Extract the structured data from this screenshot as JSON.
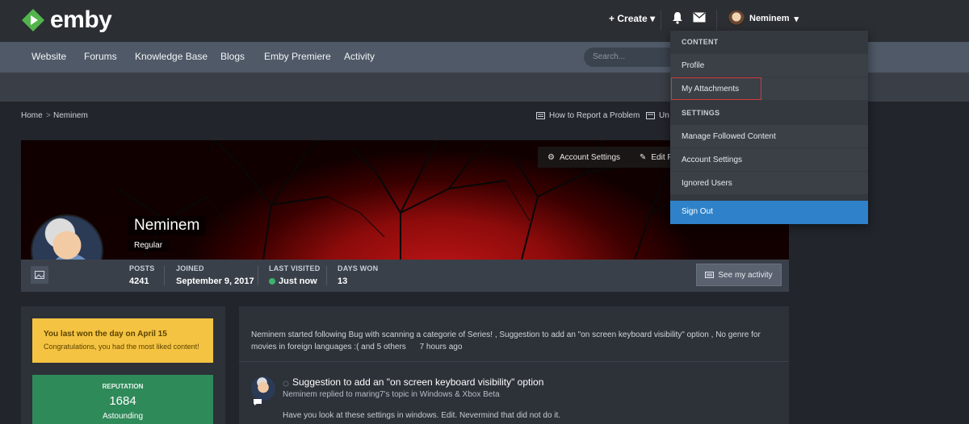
{
  "brand": {
    "name": "emby",
    "logo_color": "#52b54b"
  },
  "topbar": {
    "create_label": "Create",
    "notifications_icon": "bell-icon",
    "messages_icon": "envelope-icon",
    "username": "Neminem"
  },
  "nav": {
    "items": [
      "Website",
      "Forums",
      "Knowledge Base",
      "Blogs",
      "Emby Premiere",
      "Activity"
    ],
    "search_placeholder": "Search..."
  },
  "breadcrumb": {
    "home": "Home",
    "separator": ">",
    "current": "Neminem"
  },
  "breadcrumb_links": {
    "report": "How to Report a Problem",
    "second_truncated": "Un"
  },
  "cover": {
    "account_settings_label": "Account Settings",
    "edit_profile_label_truncated": "Edit P"
  },
  "profile": {
    "name": "Neminem",
    "title": "Regular",
    "stats": [
      {
        "label": "POSTS",
        "value": "4241"
      },
      {
        "label": "JOINED",
        "value": "September 9, 2017"
      },
      {
        "label": "LAST VISITED",
        "value": "Just now",
        "online": true
      },
      {
        "label": "DAYS WON",
        "value": "13"
      }
    ],
    "activity_button": "See my activity"
  },
  "sidebar": {
    "won": {
      "title": "You last won the day on April 15",
      "subtitle": "Congratulations, you had the most liked content!"
    },
    "reputation": {
      "label": "REPUTATION",
      "value": "1684",
      "rank": "Astounding"
    }
  },
  "feed": {
    "summary": "Neminem started following Bug with scanning a categorie of Series! , Suggestion to add an \"on screen keyboard visibility\" option , No genre for movies in foreign languages :( and 5 others",
    "summary_time": "7 hours ago",
    "item": {
      "title": "Suggestion to add an \"on screen keyboard visibility\" option",
      "meta": "Neminem replied to maring7's topic in Windows & Xbox Beta",
      "body": "Have you look at these settings in windows. Edit. Nevermind that did not do it."
    }
  },
  "dropdown": {
    "content_heading": "CONTENT",
    "content_items": [
      "Profile",
      "My Attachments"
    ],
    "settings_heading": "SETTINGS",
    "settings_items": [
      "Manage Followed Content",
      "Account Settings",
      "Ignored Users"
    ],
    "sign_out": "Sign Out",
    "highlight_color": "#d23b3b",
    "sign_out_color": "#2f82c9"
  },
  "colors": {
    "topbar": "#2b2e33",
    "navbar": "#4f5967",
    "won_box": "#f5c342",
    "reputation_box": "#2f8a5a",
    "online": "#3bb36a"
  }
}
